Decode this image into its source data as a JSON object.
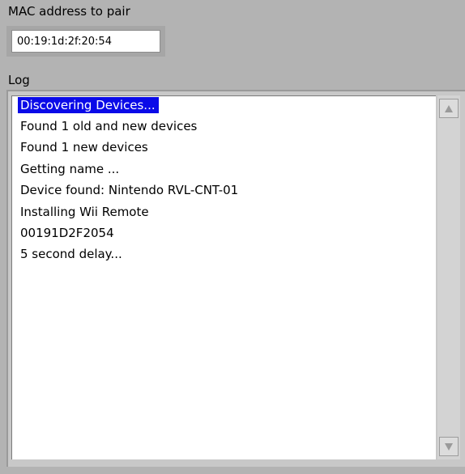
{
  "mac": {
    "label": "MAC address to pair",
    "value": "00:19:1d:2f:20:54"
  },
  "log": {
    "label": "Log",
    "lines": [
      "Discovering Devices...",
      "Found  1 old and new devices",
      "Found  1 new devices",
      "Getting name ...",
      "Device found: Nintendo RVL-CNT-01",
      "Installing Wii Remote",
      "00191D2F2054",
      "5 second delay..."
    ],
    "selected_index": 0
  },
  "icons": {
    "scroll_up": "scroll-up-arrow-icon",
    "scroll_down": "scroll-down-arrow-icon"
  },
  "colors": {
    "background": "#b3b3b3",
    "selection": "#0a0ae8",
    "selection_text": "#ffffff"
  }
}
